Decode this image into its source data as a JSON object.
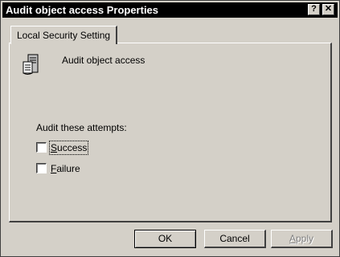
{
  "window": {
    "title": "Audit object access Properties",
    "help_glyph": "?",
    "close_glyph": "✕"
  },
  "tabs": [
    {
      "label": "Local Security Setting",
      "selected": true
    }
  ],
  "policy": {
    "icon": "policy-server-icon",
    "name": "Audit object access"
  },
  "audit": {
    "prompt": "Audit these attempts:",
    "options": [
      {
        "access_key": "S",
        "label_rest": "uccess",
        "checked": false
      },
      {
        "access_key": "F",
        "label_rest": "ailure",
        "checked": false
      }
    ]
  },
  "buttons": {
    "ok": "OK",
    "cancel": "Cancel",
    "apply_key": "A",
    "apply_rest": "pply",
    "apply_enabled": false
  },
  "colors": {
    "face": "#d4d0c8",
    "titlebar": "#000000",
    "disabled_text": "#808080"
  }
}
